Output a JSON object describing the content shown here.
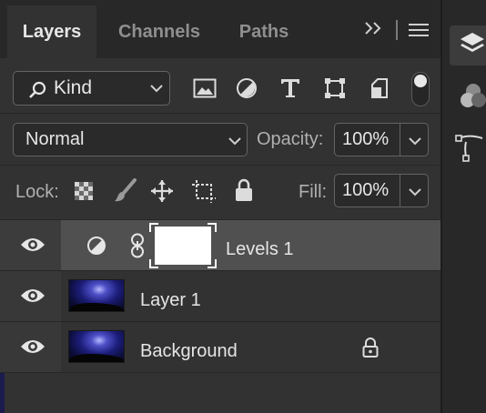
{
  "tabs": [
    {
      "label": "Layers",
      "active": true
    },
    {
      "label": "Channels",
      "active": false
    },
    {
      "label": "Paths",
      "active": false
    }
  ],
  "filter": {
    "kind_label": "Kind",
    "icons": [
      "image-filter-icon",
      "adjustment-filter-icon",
      "type-filter-icon",
      "shape-filter-icon",
      "smart-object-filter-icon"
    ],
    "toggle_on": true
  },
  "blend": {
    "mode": "Normal",
    "opacity_label": "Opacity:",
    "opacity_value": "100%"
  },
  "lock": {
    "label": "Lock:",
    "icons": [
      "lock-transparent-icon",
      "lock-image-icon",
      "lock-position-icon",
      "lock-artboard-icon",
      "lock-all-icon"
    ],
    "fill_label": "Fill:",
    "fill_value": "100%"
  },
  "layers": [
    {
      "name": "Levels 1",
      "type": "adjustment",
      "visible": true,
      "selected": true
    },
    {
      "name": "Layer 1",
      "type": "pixel",
      "visible": true,
      "selected": false
    },
    {
      "name": "Background",
      "type": "pixel",
      "visible": true,
      "selected": false,
      "locked": true
    }
  ],
  "colors": {
    "panel": "#323232",
    "tabbar": "#282828",
    "selected_row": "#505050",
    "text": "#e6e6e6",
    "muted": "#8f8f8f"
  }
}
